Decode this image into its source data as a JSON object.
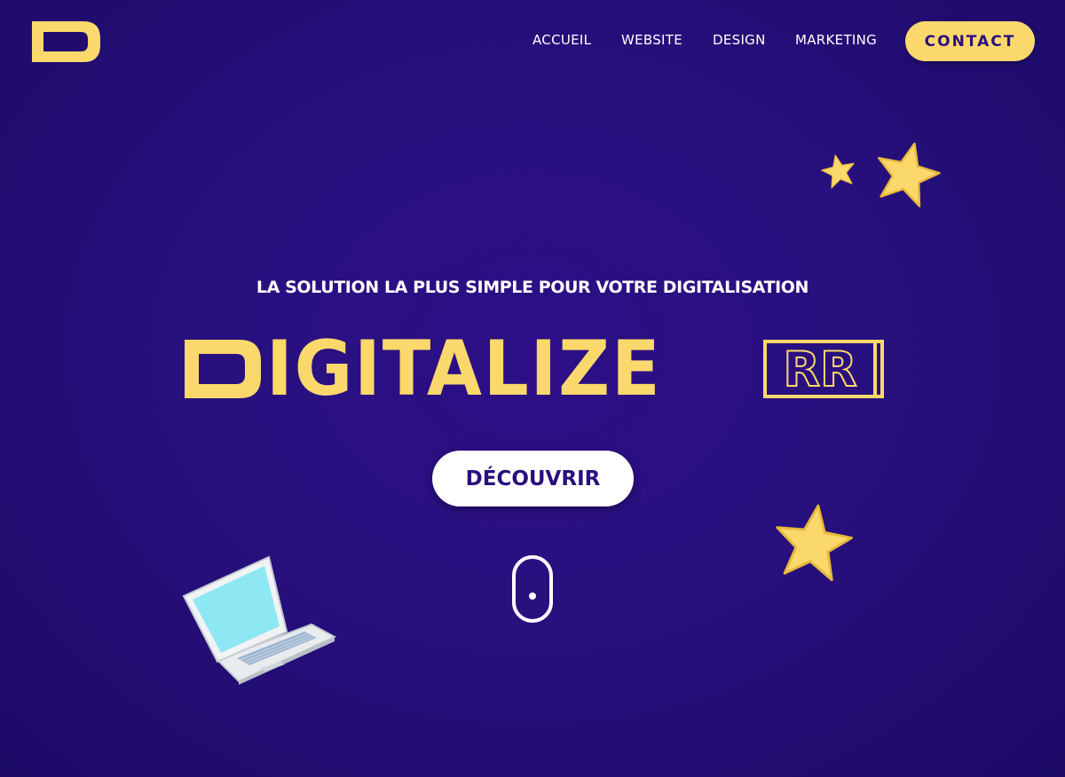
{
  "header": {
    "logo_icon": "d-logo",
    "nav": [
      {
        "label": "ACCUEIL"
      },
      {
        "label": "WEBSITE"
      },
      {
        "label": "DESIGN"
      },
      {
        "label": "MARKETING"
      }
    ],
    "contact_label": "CONTACT"
  },
  "hero": {
    "tagline": "LA SOLUTION LA PLUS SIMPLE POUR VOTRE DIGITALISATION",
    "brand_main": "IGITALIZE",
    "brand_suffix": "RR",
    "cta_label": "DÉCOUVRIR",
    "scroll_icon": "mouse-scroll-icon"
  },
  "decor": {
    "stars": [
      "star-icon",
      "star-icon",
      "star-icon"
    ],
    "laptop": "laptop-icon"
  },
  "colors": {
    "background": "#28107e",
    "accent": "#fbd86b",
    "text": "#ffffff",
    "button_text": "#2a0f7e"
  }
}
